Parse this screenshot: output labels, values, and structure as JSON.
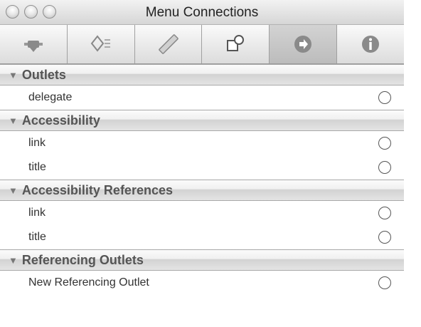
{
  "window": {
    "title": "Menu Connections"
  },
  "toolbar": {
    "tabs": [
      {
        "icon": "bindings-icon",
        "selected": false
      },
      {
        "icon": "attributes-icon",
        "selected": false
      },
      {
        "icon": "size-ruler-icon",
        "selected": false
      },
      {
        "icon": "identity-icon",
        "selected": false
      },
      {
        "icon": "connections-arrow-icon",
        "selected": true
      },
      {
        "icon": "info-icon",
        "selected": false
      }
    ]
  },
  "sections": {
    "outlets": {
      "title": "Outlets",
      "rows": [
        "delegate"
      ]
    },
    "accessibility": {
      "title": "Accessibility",
      "rows": [
        "link",
        "title"
      ]
    },
    "accessibility_references": {
      "title": "Accessibility References",
      "rows": [
        "link",
        "title"
      ]
    },
    "referencing_outlets": {
      "title": "Referencing Outlets",
      "rows": [
        "New Referencing Outlet"
      ]
    }
  },
  "colors": {
    "selected_tab": "#c6c6c6",
    "header_text": "#555555"
  }
}
